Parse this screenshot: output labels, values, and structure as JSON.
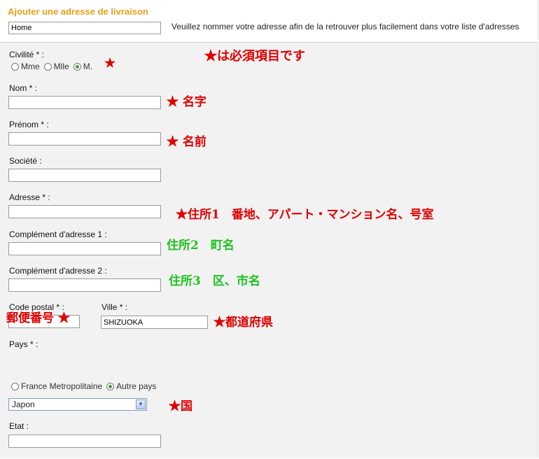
{
  "header": {
    "title": "Ajouter une adresse de livraison",
    "alias_value": "Home",
    "alias_hint": "Veuillez nommer votre adresse afin de la retrouver plus facilement dans votre liste d'adresses"
  },
  "form": {
    "civility_label": "Civilité * :",
    "civility_options": [
      "Mme",
      "Mlle",
      "M."
    ],
    "civility_selected": "M.",
    "nom_label": "Nom * :",
    "nom_value": "",
    "prenom_label": "Prénom * :",
    "prenom_value": "",
    "societe_label": "Société :",
    "societe_value": "",
    "adresse_label": "Adresse * :",
    "adresse_value": "",
    "complement1_label": "Complément d'adresse 1 :",
    "complement1_value": "",
    "complement2_label": "Complément d'adresse 2 :",
    "complement2_value": "",
    "code_postal_label": "Code postal * :",
    "code_postal_value": "",
    "ville_label": "Ville * :",
    "ville_value": "SHIZUOKA",
    "pays_label": "Pays * :",
    "pays_options": [
      "France Metropolitaine",
      "Autre pays"
    ],
    "pays_selected": "Autre pays",
    "country_select_value": "Japon",
    "etat_label": "Etat :",
    "etat_value": ""
  },
  "annotations": {
    "required_note": "★は必須項目です",
    "civility_star": "★",
    "nom_note": "★ 名字",
    "prenom_note": "★ 名前",
    "adresse_note": "★住所1　番地、アパート・マンション名、号室",
    "complement1_note": "住所2　町名",
    "complement2_note": "住所3　区、市名",
    "postal_note": "郵便番号 ★",
    "ville_note": "★都道府県",
    "country_note": "★国"
  },
  "colors": {
    "title": "#e3a21a",
    "annotation_red": "#e00000",
    "annotation_green": "#1fc21f",
    "panel_bg": "#f2f2f2"
  }
}
